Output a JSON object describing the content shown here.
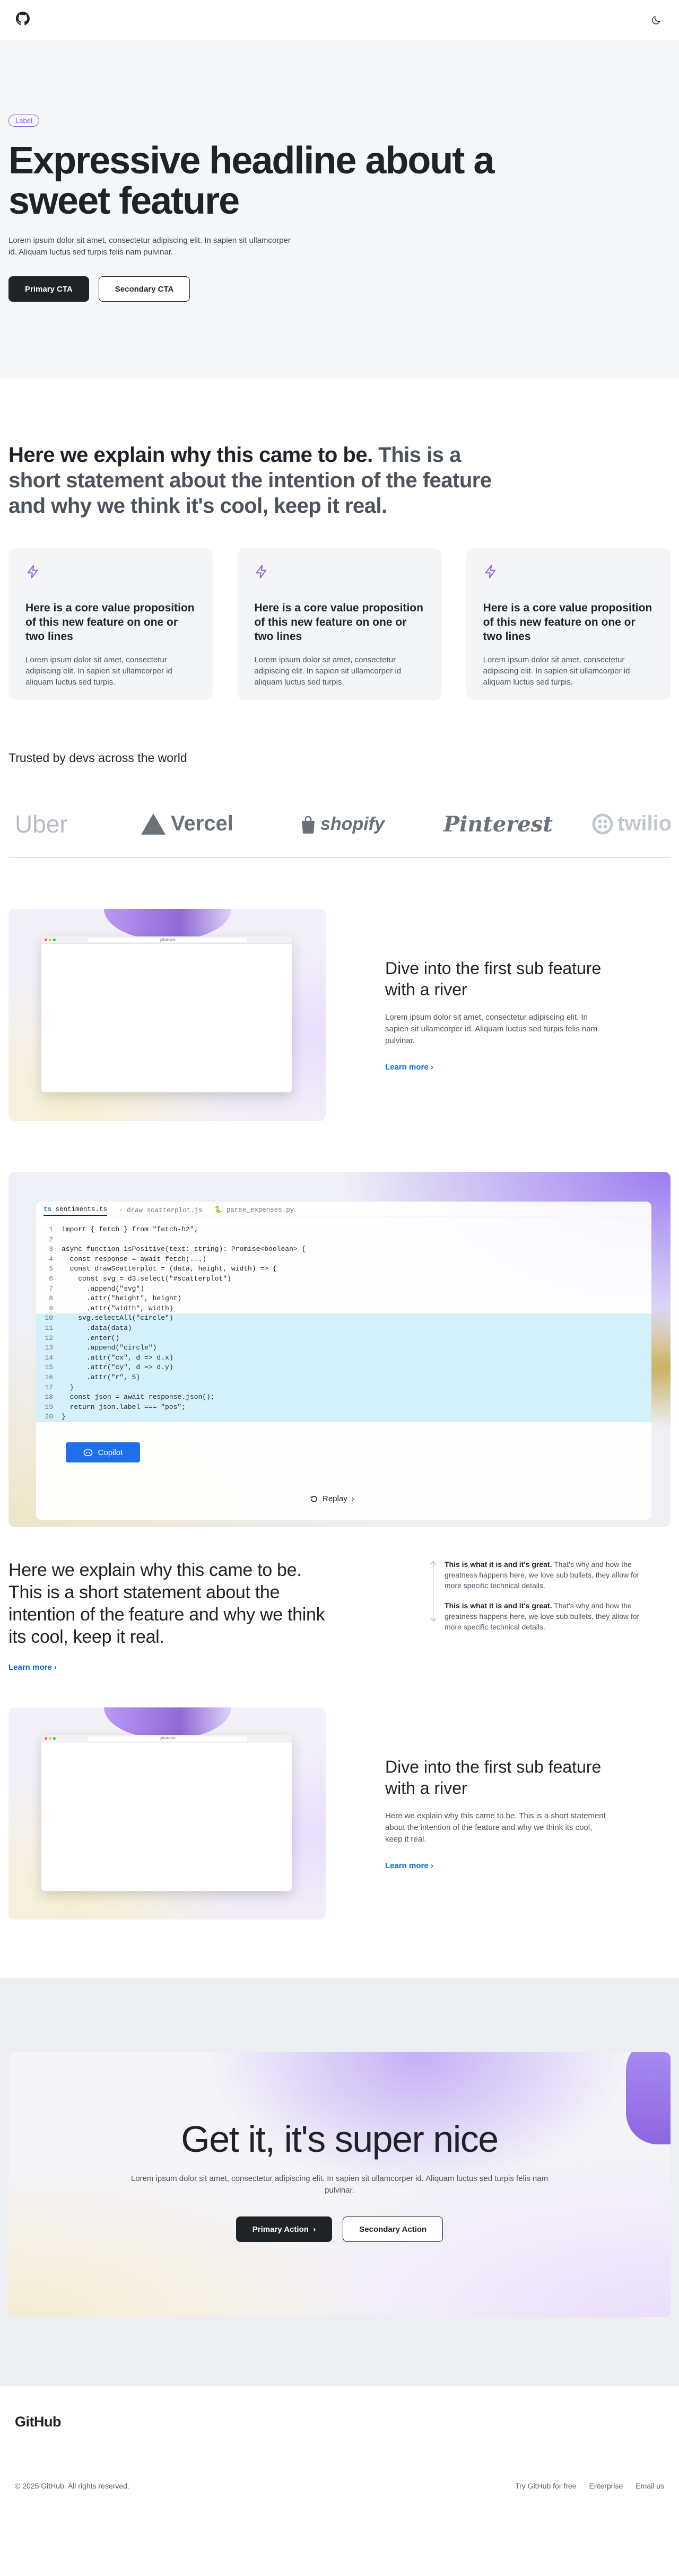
{
  "header": {
    "logo_icon": "github-mark-icon",
    "theme_icon": "moon-icon"
  },
  "hero": {
    "badge": "Label",
    "headline": "Expressive headline about a sweet feature",
    "lead": "Lorem ipsum dolor sit amet, consectetur adipiscing elit. In sapien sit ullamcorper id. Aliquam luctus sed turpis felis nam pulvinar.",
    "primary_cta": "Primary CTA",
    "secondary_cta": "Secondary CTA"
  },
  "intro": {
    "headline_strong": "Here we explain why this came to be.",
    "headline_muted": " This is a short statement about the intention of the feature and why we think it's cool, keep it real.",
    "cards": [
      {
        "icon": "bolt-icon",
        "title": "Here is a core value proposition of this new feature on one or two lines",
        "body": "Lorem ipsum dolor sit amet, consectetur adipiscing elit. In sapien sit ullamcorper id aliquam luctus sed turpis."
      },
      {
        "icon": "bolt-icon",
        "title": "Here is a core value proposition of this new feature on one or two lines",
        "body": "Lorem ipsum dolor sit amet, consectetur adipiscing elit. In sapien sit ullamcorper id aliquam luctus sed turpis."
      },
      {
        "icon": "bolt-icon",
        "title": "Here is a core value proposition of this new feature on one or two lines",
        "body": "Lorem ipsum dolor sit amet, consectetur adipiscing elit. In sapien sit ullamcorper id aliquam luctus sed turpis."
      }
    ]
  },
  "trusted": {
    "heading": "Trusted by devs across the world",
    "logos": [
      "Uber",
      "Vercel",
      "shopify",
      "Pinterest",
      "twilio"
    ]
  },
  "river1": {
    "title": "Dive into the first sub feature with a river",
    "body": "Lorem ipsum dolor sit amet, consectetur adipiscing elit. In sapien sit ullamcorper id. Aliquam luctus sed turpis felis nam pulvinar.",
    "link": "Learn more",
    "url": "github.com"
  },
  "code": {
    "tabs": [
      "sentiments.ts",
      "draw_scatterplot.js",
      "parse_expenses.py"
    ],
    "lines": [
      "import { fetch } from \"fetch-h2\";",
      "",
      "async function isPositive(text: string): Promise<boolean> {",
      "  const response = await fetch(...)",
      "  const drawScatterplot = (data, height, width) => {",
      "    const svg = d3.select(\"#scatterplot\")",
      "      .append(\"svg\")",
      "      .attr(\"height\", height)",
      "      .attr(\"width\", width)",
      "    svg.selectAll(\"circle\")",
      "      .data(data)",
      "      .enter()",
      "      .append(\"circle\")",
      "      .attr(\"cx\", d => d.x)",
      "      .attr(\"cy\", d => d.y)",
      "      .attr(\"r\", 5)",
      "  }",
      "  const json = await response.json();",
      "  return json.label === \"pos\";",
      "}"
    ],
    "copilot_label": "Copilot",
    "replay_label": "Replay"
  },
  "explain": {
    "headline": "Here we explain why this came to be. This is a short statement about the intention of the feature and why we think its cool, keep it real.",
    "link": "Learn more",
    "bullets": [
      {
        "strong": "This is what it is and it's great.",
        "text": " That's why and how the greatness happens here, we love sub bullets, they allow for more specific technical details."
      },
      {
        "strong": "This is what it is and it's great.",
        "text": " That's why and how the greatness happens here, we love sub bullets, they allow for more specific technical details."
      }
    ]
  },
  "river2": {
    "title": "Dive into the first sub feature with a river",
    "body": "Here we explain why this came to be. This is a short statement about the intention of the feature and why we think its cool, keep it real.",
    "link": "Learn more",
    "url": "github.com"
  },
  "cta": {
    "headline": "Get it, it's super nice",
    "body": "Lorem ipsum dolor sit amet, consectetur adipiscing elit. In sapien sit ullamcorper id. Aliquam luctus sed turpis felis nam pulvinar.",
    "primary": "Primary Action",
    "secondary": "Secondary Action"
  },
  "footer": {
    "brand": "GitHub",
    "copyright": "© 2025 GitHub. All rights reserved.",
    "links": [
      "Try GitHub for free",
      "Enterprise",
      "Email us"
    ]
  },
  "colors": {
    "accent": "#8a63d2",
    "link": "#0969da",
    "copilot": "#1f6feb",
    "dark": "#1f2328"
  }
}
